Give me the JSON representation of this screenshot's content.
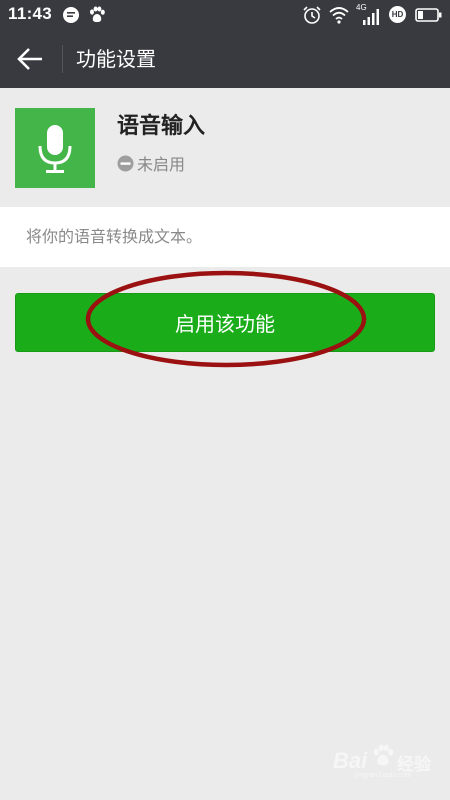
{
  "status_bar": {
    "time": "11:43",
    "network_type": "4G",
    "hd_badge": "HD",
    "icons": [
      "message-bubble-icon",
      "baidu-paw-icon",
      "alarm-icon",
      "wifi-icon",
      "signal-icon",
      "hd-badge-icon",
      "battery-icon"
    ]
  },
  "title_bar": {
    "title": "功能设置",
    "back_icon": "arrow-left-icon"
  },
  "plugin": {
    "name": "语音输入",
    "status": "未启用",
    "status_icon": "minus-circle-icon",
    "icon": "microphone-icon",
    "icon_bg_color": "#44b549",
    "description": "将你的语音转换成文本。"
  },
  "actions": {
    "enable_label": "启用该功能",
    "enable_color": "#1aad19",
    "annotation_color": "#9b1111"
  },
  "watermark": {
    "text": "Bai",
    "subtext": "经验",
    "domain": "jingyan.baidu.com"
  },
  "colors": {
    "header_bg": "#393a3f",
    "page_bg": "#ebebeb"
  }
}
